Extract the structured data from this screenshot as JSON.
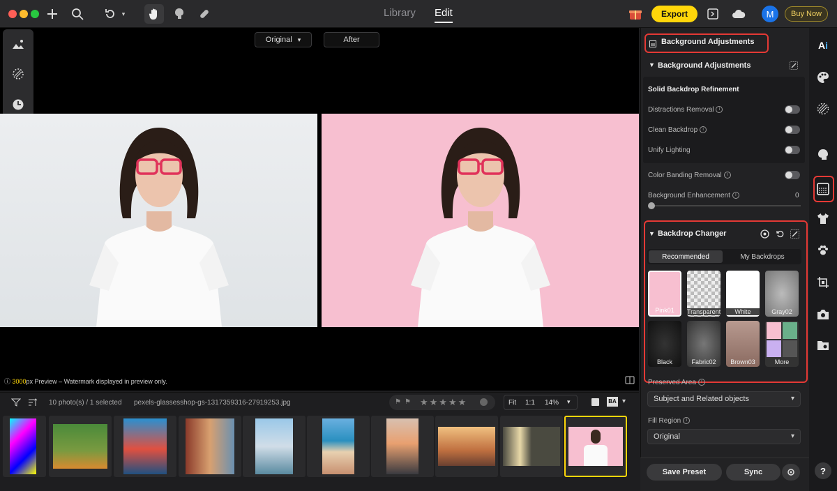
{
  "toolbar": {
    "nav_tabs": [
      "Library",
      "Edit"
    ],
    "export_label": "Export",
    "buy_now_label": "Buy Now",
    "avatar_initial": "M"
  },
  "canvas": {
    "view_selector": "Original",
    "after_label": "After",
    "preview_px": "3000",
    "preview_note": "px Preview – Watermark displayed in preview only."
  },
  "filmstrip": {
    "count_text": "10 photo(s) / 1 selected",
    "filename": "pexels-glassesshop-gs-1317359316-27919253.jpg",
    "zoom_fit": "Fit",
    "zoom_ratio": "1:1",
    "zoom_percent": "14%"
  },
  "panel": {
    "header_title": "Background Adjustments",
    "section_title": "Background Adjustments",
    "subsection_title": "Solid Backdrop Refinement",
    "rows": {
      "distractions": "Distractions Removal",
      "clean": "Clean Backdrop",
      "unify": "Unify Lighting",
      "banding": "Color Banding Removal",
      "enhancement": "Background Enhancement",
      "enhancement_value": "0"
    },
    "backdrop_changer": {
      "title": "Backdrop Changer",
      "tabs": [
        "Recommended",
        "My Backdrops"
      ],
      "tiles": [
        "Pink01",
        "Transparent",
        "White",
        "Gray02",
        "Black",
        "Fabric02",
        "Brown03",
        "More"
      ]
    },
    "preserved_label": "Preserved Area",
    "preserved_value": "Subject and Related objects",
    "fill_region_label": "Fill Region",
    "fill_region_value": "Original",
    "save_preset": "Save Preset",
    "sync": "Sync"
  },
  "colors": {
    "accent": "#ffd60a",
    "highlight": "#e53935",
    "pink_backdrop": "#f7bfd0"
  }
}
